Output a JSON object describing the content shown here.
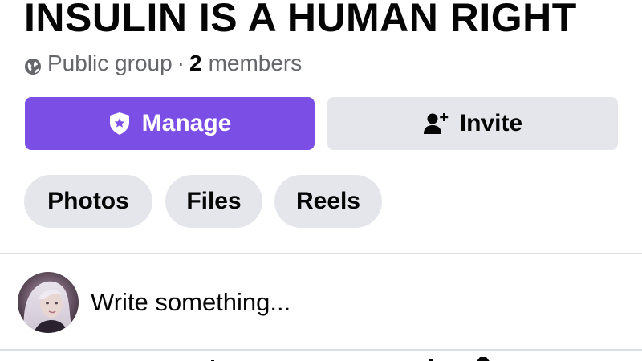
{
  "group": {
    "name": "INSULIN IS A HUMAN RIGHT",
    "privacy": "Public group",
    "separator": "·",
    "member_count": "2",
    "member_label": "members"
  },
  "actions": {
    "manage_label": "Manage",
    "invite_label": "Invite"
  },
  "tabs": [
    {
      "label": "Photos"
    },
    {
      "label": "Files"
    },
    {
      "label": "Reels"
    }
  ],
  "composer": {
    "placeholder": "Write something..."
  },
  "icons": {
    "privacy": "globe-icon",
    "manage": "shield-star-icon",
    "invite": "add-person-icon"
  },
  "colors": {
    "accent": "#7b4fe6",
    "secondary_button": "#e4e6eb",
    "muted_text": "#65676b",
    "text": "#050505"
  }
}
